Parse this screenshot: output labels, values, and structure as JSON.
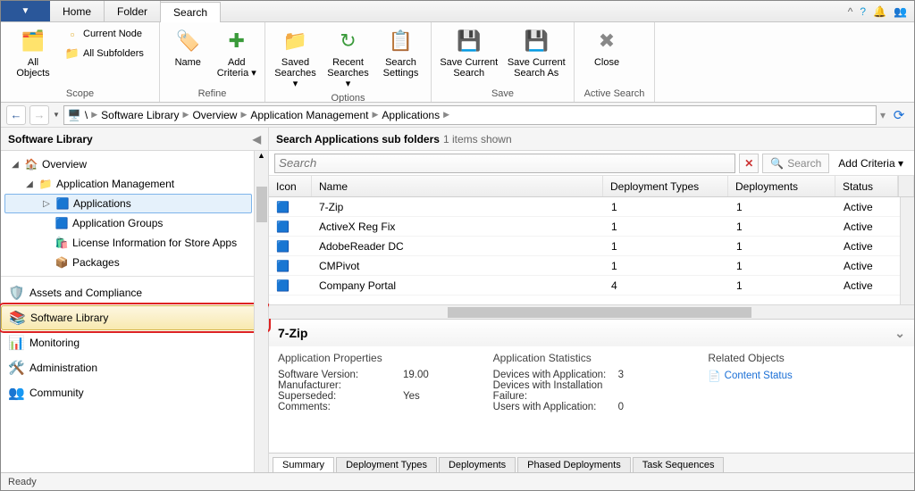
{
  "tabs": {
    "home": "Home",
    "folder": "Folder",
    "search": "Search"
  },
  "title_icons": {
    "help": "?",
    "bell": "🔔",
    "people": "👥"
  },
  "ribbon": {
    "scope": {
      "label": "Scope",
      "all_objects": "All\nObjects",
      "current_node": "Current Node",
      "all_subfolders": "All Subfolders"
    },
    "refine": {
      "label": "Refine",
      "name": "Name",
      "add_criteria": "Add\nCriteria ▾"
    },
    "options": {
      "label": "Options",
      "saved_searches": "Saved\nSearches ▾",
      "recent_searches": "Recent\nSearches ▾",
      "search_settings": "Search\nSettings"
    },
    "save": {
      "label": "Save",
      "save_current_search": "Save Current\nSearch",
      "save_current_search_as": "Save Current\nSearch As"
    },
    "active_search": {
      "label": "Active Search",
      "close": "Close"
    }
  },
  "breadcrumb": {
    "root": "\\",
    "items": [
      "Software Library",
      "Overview",
      "Application Management",
      "Applications"
    ]
  },
  "left": {
    "title": "Software Library",
    "tree": {
      "overview": "Overview",
      "app_mgmt": "Application Management",
      "applications": "Applications",
      "app_groups": "Application Groups",
      "license_info": "License Information for Store Apps",
      "packages": "Packages"
    },
    "workspaces": {
      "assets": "Assets and Compliance",
      "software_library": "Software Library",
      "monitoring": "Monitoring",
      "administration": "Administration",
      "community": "Community"
    }
  },
  "right": {
    "header_title": "Search Applications sub folders",
    "header_sub": "1 items shown",
    "search_placeholder": "Search",
    "search_btn": "Search",
    "add_criteria": "Add Criteria ▾",
    "columns": {
      "icon": "Icon",
      "name": "Name",
      "dtypes": "Deployment Types",
      "deployments": "Deployments",
      "status": "Status"
    },
    "rows": [
      {
        "name": "7-Zip",
        "dt": "1",
        "dep": "1",
        "status": "Active"
      },
      {
        "name": "ActiveX Reg Fix",
        "dt": "1",
        "dep": "1",
        "status": "Active"
      },
      {
        "name": "AdobeReader DC",
        "dt": "1",
        "dep": "1",
        "status": "Active"
      },
      {
        "name": "CMPivot",
        "dt": "1",
        "dep": "1",
        "status": "Active"
      },
      {
        "name": "Company Portal",
        "dt": "4",
        "dep": "1",
        "status": "Active"
      }
    ]
  },
  "detail": {
    "title": "7-Zip",
    "app_props": "Application Properties",
    "app_stats": "Application Statistics",
    "related": "Related Objects",
    "content_status": "Content Status",
    "props": {
      "sw_version_k": "Software Version:",
      "sw_version_v": "19.00",
      "mfr_k": "Manufacturer:",
      "mfr_v": "",
      "superseded_k": "Superseded:",
      "superseded_v": "Yes",
      "comments_k": "Comments:",
      "comments_v": ""
    },
    "stats": {
      "dev_app_k": "Devices with Application:",
      "dev_app_v": "3",
      "dev_inst_k": "Devices with Installation",
      "dev_inst_v": "",
      "failure_k": "Failure:",
      "failure_v": "",
      "users_k": "Users with Application:",
      "users_v": "0"
    },
    "tabs": [
      "Summary",
      "Deployment Types",
      "Deployments",
      "Phased Deployments",
      "Task Sequences"
    ]
  },
  "status_bar": "Ready"
}
